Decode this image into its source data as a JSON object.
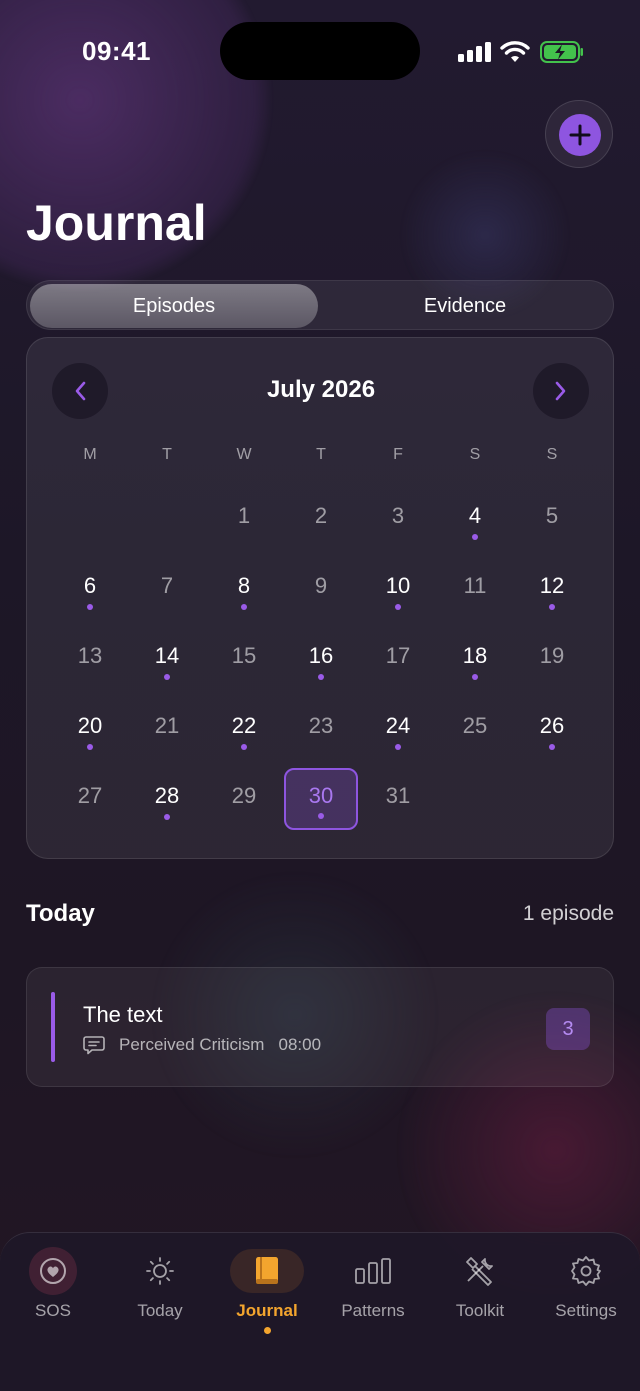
{
  "status_bar": {
    "time": "09:41"
  },
  "header": {
    "title": "Journal",
    "add_icon": "plus-icon"
  },
  "segments": [
    {
      "label": "Episodes",
      "active": true
    },
    {
      "label": "Evidence",
      "active": false
    }
  ],
  "calendar": {
    "month_label": "July 2026",
    "weekdays": [
      "M",
      "T",
      "W",
      "T",
      "F",
      "S",
      "S"
    ],
    "days": [
      {
        "n": "1",
        "dot": false
      },
      {
        "n": "2",
        "dot": false
      },
      {
        "n": "3",
        "dot": false
      },
      {
        "n": "4",
        "dot": true
      },
      {
        "n": "5",
        "dot": false
      },
      {
        "n": "6",
        "dot": true
      },
      {
        "n": "7",
        "dot": false
      },
      {
        "n": "8",
        "dot": true
      },
      {
        "n": "9",
        "dot": false
      },
      {
        "n": "10",
        "dot": true
      },
      {
        "n": "11",
        "dot": false
      },
      {
        "n": "12",
        "dot": true
      },
      {
        "n": "13",
        "dot": false
      },
      {
        "n": "14",
        "dot": true
      },
      {
        "n": "15",
        "dot": false
      },
      {
        "n": "16",
        "dot": true
      },
      {
        "n": "17",
        "dot": false
      },
      {
        "n": "18",
        "dot": true
      },
      {
        "n": "19",
        "dot": false
      },
      {
        "n": "20",
        "dot": true
      },
      {
        "n": "21",
        "dot": false
      },
      {
        "n": "22",
        "dot": true
      },
      {
        "n": "23",
        "dot": false
      },
      {
        "n": "24",
        "dot": true
      },
      {
        "n": "25",
        "dot": false
      },
      {
        "n": "26",
        "dot": true
      },
      {
        "n": "27",
        "dot": false
      },
      {
        "n": "28",
        "dot": true
      },
      {
        "n": "29",
        "dot": false
      },
      {
        "n": "30",
        "dot": true,
        "selected": true
      },
      {
        "n": "31",
        "dot": false
      }
    ],
    "first_weekday_index": 2
  },
  "today_section": {
    "title": "Today",
    "count": "1 episode"
  },
  "episodes": [
    {
      "title": "The text",
      "trigger": "Perceived Criticism",
      "time": "08:00",
      "intensity": "3"
    }
  ],
  "tabbar": [
    {
      "label": "SOS",
      "icon": "heart-icon",
      "active": false
    },
    {
      "label": "Today",
      "icon": "sun-icon",
      "active": false
    },
    {
      "label": "Journal",
      "icon": "book-icon",
      "active": true
    },
    {
      "label": "Patterns",
      "icon": "bar-chart-icon",
      "active": false
    },
    {
      "label": "Toolkit",
      "icon": "tools-icon",
      "active": false
    },
    {
      "label": "Settings",
      "icon": "gear-icon",
      "active": false
    }
  ],
  "colors": {
    "accent": "#8e55e0",
    "tab_active": "#f3a52e",
    "dot": "#9a5be8"
  }
}
